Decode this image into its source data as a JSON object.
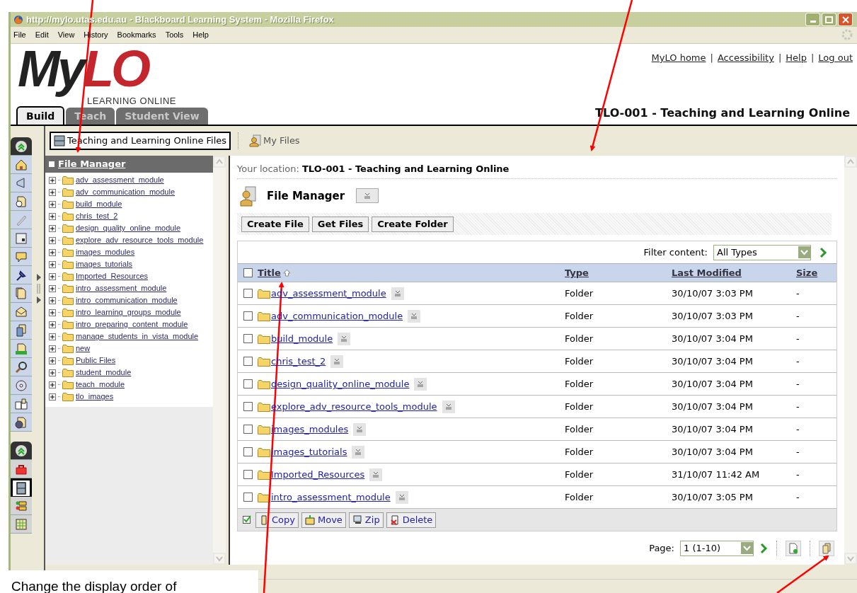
{
  "window": {
    "title": "http://mylo.utas.edu.au - Blackboard Learning System - Mozilla Firefox"
  },
  "menu": [
    "File",
    "Edit",
    "View",
    "History",
    "Bookmarks",
    "Tools",
    "Help"
  ],
  "logo": {
    "dark_part": "My",
    "red_part": "LO",
    "tagline": "LEARNING ONLINE"
  },
  "top_links": [
    {
      "kind": "link",
      "text": "MyLO home"
    },
    {
      "kind": "separator",
      "text": "|"
    },
    {
      "kind": "link",
      "text": "Accessibility"
    },
    {
      "kind": "separator",
      "text": "|"
    },
    {
      "kind": "link",
      "text": "Help"
    },
    {
      "kind": "separator",
      "text": "|"
    },
    {
      "kind": "link",
      "text": "Log out"
    }
  ],
  "tabs": [
    {
      "label": "Build",
      "selected": true
    },
    {
      "label": "Teach",
      "selected": false
    },
    {
      "label": "Student View",
      "selected": false
    }
  ],
  "course_title": "TLO-001 - Teaching and Learning Online",
  "file_tabs": [
    {
      "label": "Teaching and Learning Online Files",
      "selected": true
    },
    {
      "label": "My Files",
      "selected": false
    }
  ],
  "tree": {
    "title": "File Manager",
    "items": [
      "adv_assessment_module",
      "adv_communication_module",
      "build_module",
      "chris_test_2",
      "design_quality_online_module",
      "explore_adv_resource_tools_module",
      "images_modules",
      "images_tutorials",
      "Imported_Resources",
      "intro_assessment_module",
      "intro_communication_module",
      "intro_learning_groups_module",
      "intro_preparing_content_module",
      "manage_students_in_vista_module",
      "new",
      "Public Files",
      "student_module",
      "teach_module",
      "tlo_images"
    ]
  },
  "location": {
    "label": "Your location:",
    "value": "TLO-001 - Teaching and Learning Online"
  },
  "page_title": "File Manager",
  "actions": [
    "Create File",
    "Get Files",
    "Create Folder"
  ],
  "filter": {
    "label": "Filter content:",
    "value": "All Types"
  },
  "select_all_checked": false,
  "columns": [
    {
      "label": "Title",
      "sorted": true
    },
    {
      "label": "Type",
      "sorted": false
    },
    {
      "label": "Last Modified",
      "sorted": false
    },
    {
      "label": "Size",
      "sorted": false
    }
  ],
  "rows": [
    {
      "title": "adv_assessment_module",
      "type": "Folder",
      "modified": "30/10/07 3:03 PM",
      "size": "-",
      "checked": false
    },
    {
      "title": "adv_communication_module",
      "type": "Folder",
      "modified": "30/10/07 3:03 PM",
      "size": "-",
      "checked": false
    },
    {
      "title": "build_module",
      "type": "Folder",
      "modified": "30/10/07 3:04 PM",
      "size": "-",
      "checked": false
    },
    {
      "title": "chris_test_2",
      "type": "Folder",
      "modified": "30/10/07 3:04 PM",
      "size": "-",
      "checked": false
    },
    {
      "title": "design_quality_online_module",
      "type": "Folder",
      "modified": "30/10/07 3:04 PM",
      "size": "-",
      "checked": false
    },
    {
      "title": "explore_adv_resource_tools_module",
      "type": "Folder",
      "modified": "30/10/07 3:04 PM",
      "size": "-",
      "checked": false
    },
    {
      "title": "images_modules",
      "type": "Folder",
      "modified": "30/10/07 3:04 PM",
      "size": "-",
      "checked": false
    },
    {
      "title": "images_tutorials",
      "type": "Folder",
      "modified": "30/10/07 3:04 PM",
      "size": "-",
      "checked": false
    },
    {
      "title": "Imported_Resources",
      "type": "Folder",
      "modified": "31/10/07 11:42 AM",
      "size": "-",
      "checked": false
    },
    {
      "title": "intro_assessment_module",
      "type": "Folder",
      "modified": "30/10/07 3:05 PM",
      "size": "-",
      "checked": false
    }
  ],
  "bulk_actions": [
    "Copy",
    "Move",
    "Zip",
    "Delete"
  ],
  "pager": {
    "label": "Page:",
    "value": "1 (1-10)"
  },
  "caption": "Change the display order of"
}
